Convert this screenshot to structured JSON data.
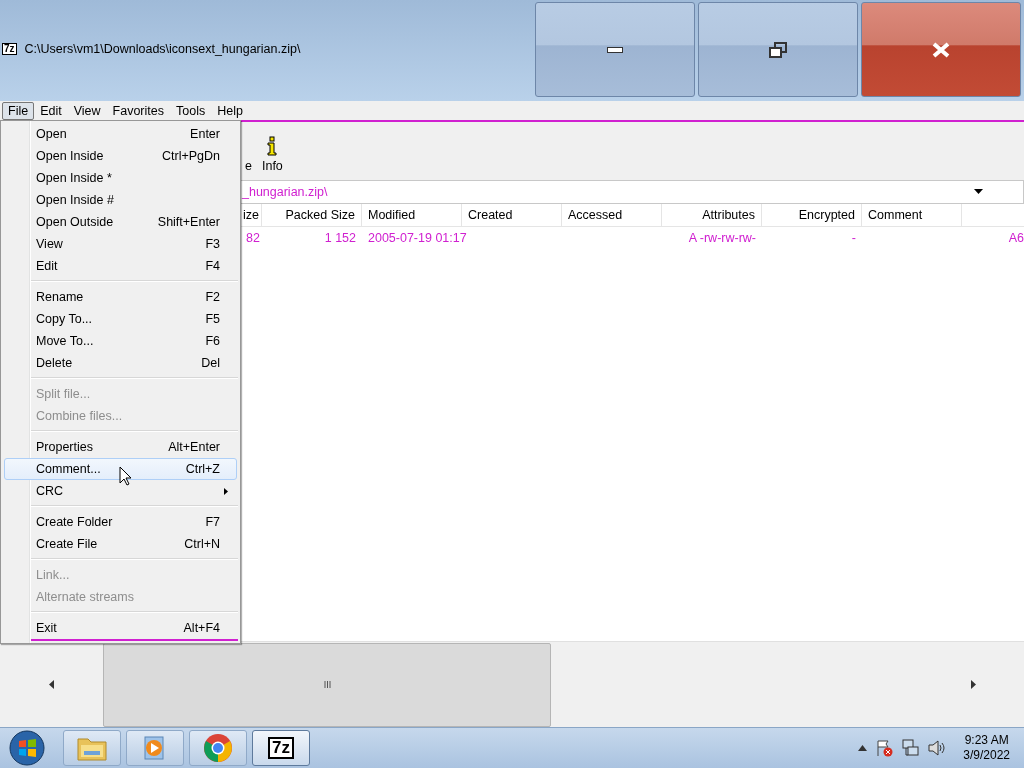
{
  "window": {
    "icon_text": "7z",
    "title": "C:\\Users\\vm1\\Downloads\\iconsext_hungarian.zip\\"
  },
  "menu_bar": [
    {
      "label": "File",
      "selected": true
    },
    {
      "label": "Edit",
      "selected": false
    },
    {
      "label": "View",
      "selected": false
    },
    {
      "label": "Favorites",
      "selected": false
    },
    {
      "label": "Tools",
      "selected": false
    },
    {
      "label": "Help",
      "selected": false
    }
  ],
  "toolbar": [
    {
      "label": "e",
      "kind": "text"
    },
    {
      "label": "Info",
      "kind": "info"
    }
  ],
  "address": {
    "value": "_hungarian.zip\\"
  },
  "table": {
    "columns": [
      {
        "label": "ize",
        "kind": "right"
      },
      {
        "label": "Packed Size",
        "kind": "right"
      },
      {
        "label": "Modified",
        "kind": "left"
      },
      {
        "label": "Created",
        "kind": "left"
      },
      {
        "label": "Accessed",
        "kind": "left"
      },
      {
        "label": "Attributes",
        "kind": "right"
      },
      {
        "label": "Encrypted",
        "kind": "right"
      },
      {
        "label": "Comment",
        "kind": "left"
      }
    ],
    "rows": [
      {
        "cells": [
          "82",
          "1 152",
          "2005-07-19 01:17",
          "",
          "",
          "A -rw-rw-rw-",
          "-",
          "",
          "A6"
        ]
      }
    ]
  },
  "file_menu": [
    [
      {
        "label": "Open",
        "shortcut": "Enter",
        "disabled": false,
        "selected": false,
        "submenu": false
      },
      {
        "label": "Open Inside",
        "shortcut": "Ctrl+PgDn",
        "disabled": false,
        "selected": false,
        "submenu": false
      },
      {
        "label": "Open Inside *",
        "disabled": false,
        "selected": false,
        "submenu": false
      },
      {
        "label": "Open Inside #",
        "disabled": false,
        "selected": false,
        "submenu": false
      },
      {
        "label": "Open Outside",
        "shortcut": "Shift+Enter",
        "disabled": false,
        "selected": false,
        "submenu": false
      },
      {
        "label": "View",
        "shortcut": "F3",
        "disabled": false,
        "selected": false,
        "submenu": false
      },
      {
        "label": "Edit",
        "shortcut": "F4",
        "disabled": false,
        "selected": false,
        "submenu": false
      }
    ],
    [
      {
        "label": "Rename",
        "shortcut": "F2",
        "disabled": false,
        "selected": false,
        "submenu": false
      },
      {
        "label": "Copy To...",
        "shortcut": "F5",
        "disabled": false,
        "selected": false,
        "submenu": false
      },
      {
        "label": "Move To...",
        "shortcut": "F6",
        "disabled": false,
        "selected": false,
        "submenu": false
      },
      {
        "label": "Delete",
        "shortcut": "Del",
        "disabled": false,
        "selected": false,
        "submenu": false
      }
    ],
    [
      {
        "label": "Split file...",
        "disabled": true,
        "selected": false,
        "submenu": false
      },
      {
        "label": "Combine files...",
        "disabled": true,
        "selected": false,
        "submenu": false
      }
    ],
    [
      {
        "label": "Properties",
        "shortcut": "Alt+Enter",
        "disabled": false,
        "selected": false,
        "submenu": false
      },
      {
        "label": "Comment...",
        "shortcut": "Ctrl+Z",
        "disabled": false,
        "selected": true,
        "submenu": false
      },
      {
        "label": "CRC",
        "disabled": false,
        "selected": false,
        "submenu": true
      }
    ],
    [
      {
        "label": "Create Folder",
        "shortcut": "F7",
        "disabled": false,
        "selected": false,
        "submenu": false
      },
      {
        "label": "Create File",
        "shortcut": "Ctrl+N",
        "disabled": false,
        "selected": false,
        "submenu": false
      }
    ],
    [
      {
        "label": "Link...",
        "disabled": true,
        "selected": false,
        "submenu": false
      },
      {
        "label": "Alternate streams",
        "disabled": true,
        "selected": false,
        "submenu": false
      }
    ],
    [
      {
        "label": "Exit",
        "shortcut": "Alt+F4",
        "disabled": false,
        "selected": false,
        "submenu": false
      }
    ]
  ],
  "taskbar": {
    "apps": [
      {
        "kind": "explorer",
        "selected": false
      },
      {
        "kind": "media",
        "selected": false
      },
      {
        "kind": "chrome",
        "selected": false
      },
      {
        "kind": "sevenzip",
        "label": "7z",
        "selected": true
      }
    ],
    "clock": {
      "time": "9:23 AM",
      "date": "3/9/2022"
    }
  }
}
